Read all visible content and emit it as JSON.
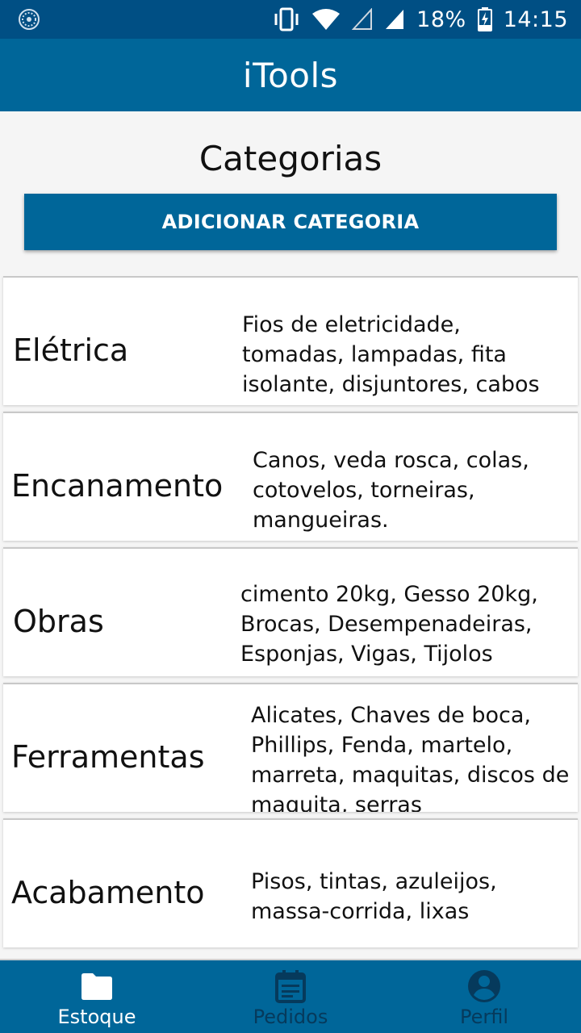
{
  "status_bar": {
    "battery": "18%",
    "time": "14:15",
    "icons": [
      "notification-icon",
      "vibrate-icon",
      "wifi-icon",
      "signal-empty-icon",
      "signal-icon",
      "battery-charging-icon"
    ]
  },
  "app_bar": {
    "title": "iTools"
  },
  "page": {
    "title": "Categorias",
    "add_button_label": "ADICIONAR CATEGORIA"
  },
  "categories": [
    {
      "name": "Elétrica",
      "description": "Fios de eletricidade, tomadas, lampadas, fita isolante, disjuntores, cabos"
    },
    {
      "name": "Encanamento",
      "description": "Canos, veda rosca, colas, cotovelos, torneiras, mangueiras."
    },
    {
      "name": "Obras",
      "description": "cimento 20kg, Gesso 20kg, Brocas, Desempenadeiras, Esponjas, Vigas, Tijolos"
    },
    {
      "name": "Ferramentas",
      "description": "Alicates, Chaves de boca, Phillips, Fenda, martelo, marreta, maquitas, discos de maquita, serras"
    },
    {
      "name": "Acabamento",
      "description": "Pisos, tintas, azuleijos, massa-corrida, lixas"
    }
  ],
  "bottom_nav": {
    "items": [
      {
        "label": "Estoque",
        "icon": "folder-icon",
        "active": true
      },
      {
        "label": "Pedidos",
        "icon": "calendar-list-icon",
        "active": false
      },
      {
        "label": "Perfil",
        "icon": "account-circle-icon",
        "active": false
      }
    ]
  },
  "colors": {
    "status_bar": "#004f84",
    "primary": "#006699",
    "nav_inactive": "#063a5c",
    "background": "#f5f5f5"
  }
}
